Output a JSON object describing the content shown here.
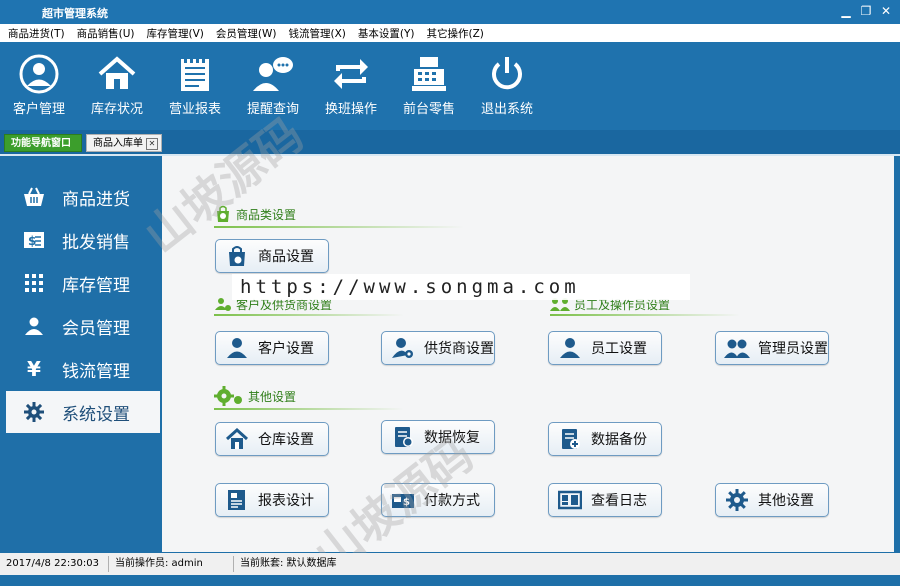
{
  "window": {
    "title": "超市管理系统"
  },
  "menu": [
    "商品进货(T)",
    "商品销售(U)",
    "库存管理(V)",
    "会员管理(W)",
    "钱流管理(X)",
    "基本设置(Y)",
    "其它操作(Z)"
  ],
  "toolbar": [
    {
      "label": "客户管理",
      "icon": "user-circle-icon"
    },
    {
      "label": "库存状况",
      "icon": "house-icon"
    },
    {
      "label": "营业报表",
      "icon": "notepad-icon"
    },
    {
      "label": "提醒查询",
      "icon": "chat-user-icon"
    },
    {
      "label": "换班操作",
      "icon": "swap-arrows-icon"
    },
    {
      "label": "前台零售",
      "icon": "cash-register-icon"
    },
    {
      "label": "退出系统",
      "icon": "power-icon"
    }
  ],
  "tabs": [
    {
      "label": "功能导航窗口"
    },
    {
      "label": "商品入库单"
    }
  ],
  "sidebar": [
    {
      "label": "商品进货",
      "icon": "basket-icon"
    },
    {
      "label": "批发销售",
      "icon": "money-icon"
    },
    {
      "label": "库存管理",
      "icon": "grid-icon"
    },
    {
      "label": "会员管理",
      "icon": "member-icon"
    },
    {
      "label": "钱流管理",
      "icon": "yen-icon"
    },
    {
      "label": "系统设置",
      "icon": "gear-icon"
    }
  ],
  "sections": {
    "goods": {
      "title": "商品类设置"
    },
    "partners": {
      "title": "客户及供货商设置"
    },
    "staff": {
      "title": "员工及操作员设置"
    },
    "other": {
      "title": "其他设置"
    }
  },
  "buttons": {
    "goods_settings": "商品设置",
    "customer_settings": "客户设置",
    "supplier_settings": "供货商设置",
    "employee_settings": "员工设置",
    "admin_settings": "管理员设置",
    "warehouse_settings": "仓库设置",
    "data_restore": "数据恢复",
    "data_backup": "数据备份",
    "report_design": "报表设计",
    "payment_method": "付款方式",
    "view_log": "查看日志",
    "other_settings": "其他设置"
  },
  "watermark": {
    "url": "https://www.songma.com",
    "text": "山坡源码"
  },
  "status": {
    "datetime": "2017/4/8 22:30:03",
    "operator": "当前操作员: admin",
    "account": "当前账套: 默认数据库"
  },
  "colors": {
    "accent_blue": "#1f72ad",
    "green_title": "#2f7e19",
    "tab_green": "#3c9e2c"
  }
}
